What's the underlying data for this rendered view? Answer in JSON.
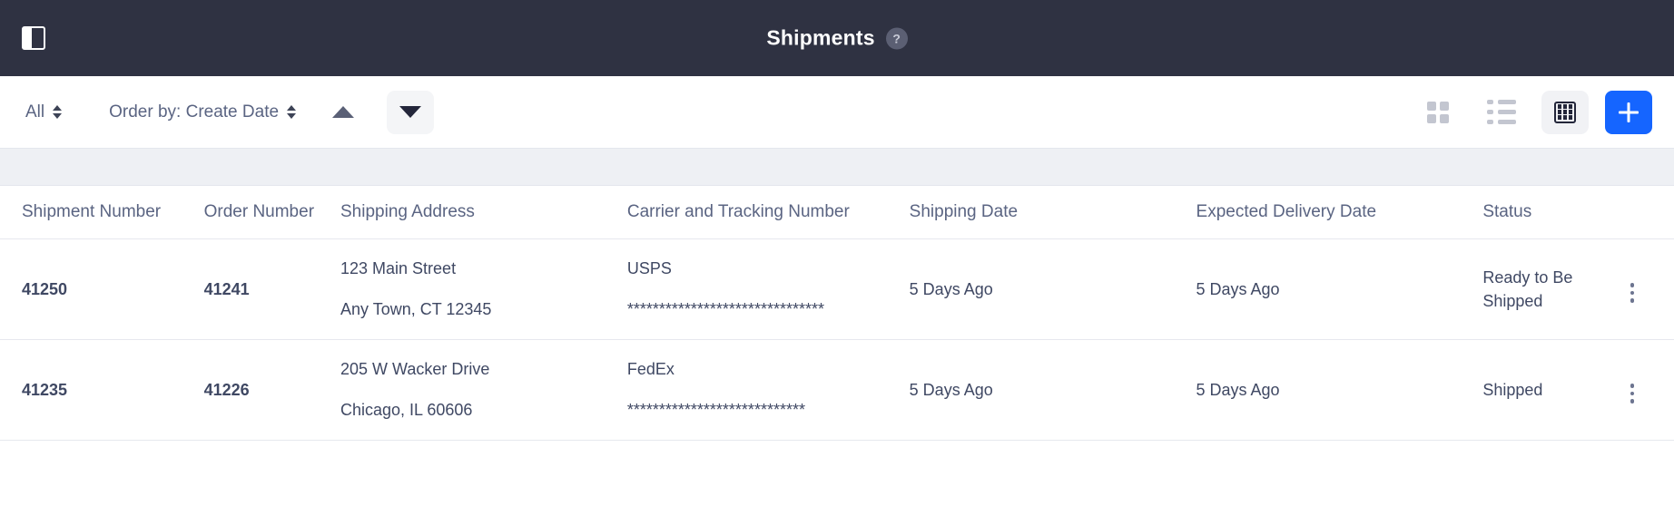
{
  "header": {
    "title": "Shipments",
    "help_label": "?",
    "sidebar_toggle_icon": "sidebar-toggle-icon"
  },
  "toolbar": {
    "filter_label": "All",
    "order_by_label": "Order by: Create Date",
    "sort_ascending_icon": "triangle-up-icon",
    "sort_descending_icon": "triangle-down-icon",
    "view_grid_icon": "grid-view-icon",
    "view_list_icon": "list-view-icon",
    "view_table_icon": "table-view-icon",
    "add_label": "+"
  },
  "table": {
    "columns": [
      "Shipment Number",
      "Order Number",
      "Shipping Address",
      "Carrier and Tracking Number",
      "Shipping Date",
      "Expected Delivery Date",
      "Status"
    ],
    "rows": [
      {
        "shipment_number": "41250",
        "order_number": "41241",
        "address_line1": "123 Main Street",
        "address_line2": "Any Town, CT 12345",
        "carrier": "USPS",
        "tracking": "*******************************",
        "shipping_date": "5 Days Ago",
        "expected_delivery_date": "5 Days Ago",
        "status": "Ready to Be Shipped"
      },
      {
        "shipment_number": "41235",
        "order_number": "41226",
        "address_line1": "205 W Wacker Drive",
        "address_line2": "Chicago, IL 60606",
        "carrier": "FedEx",
        "tracking": "****************************",
        "shipping_date": "5 Days Ago",
        "expected_delivery_date": "5 Days Ago",
        "status": "Shipped"
      }
    ]
  },
  "colors": {
    "header_bg": "#2f3242",
    "accent_blue": "#1565ff",
    "band_bg": "#eef0f4",
    "header_text": "#5a6482"
  }
}
